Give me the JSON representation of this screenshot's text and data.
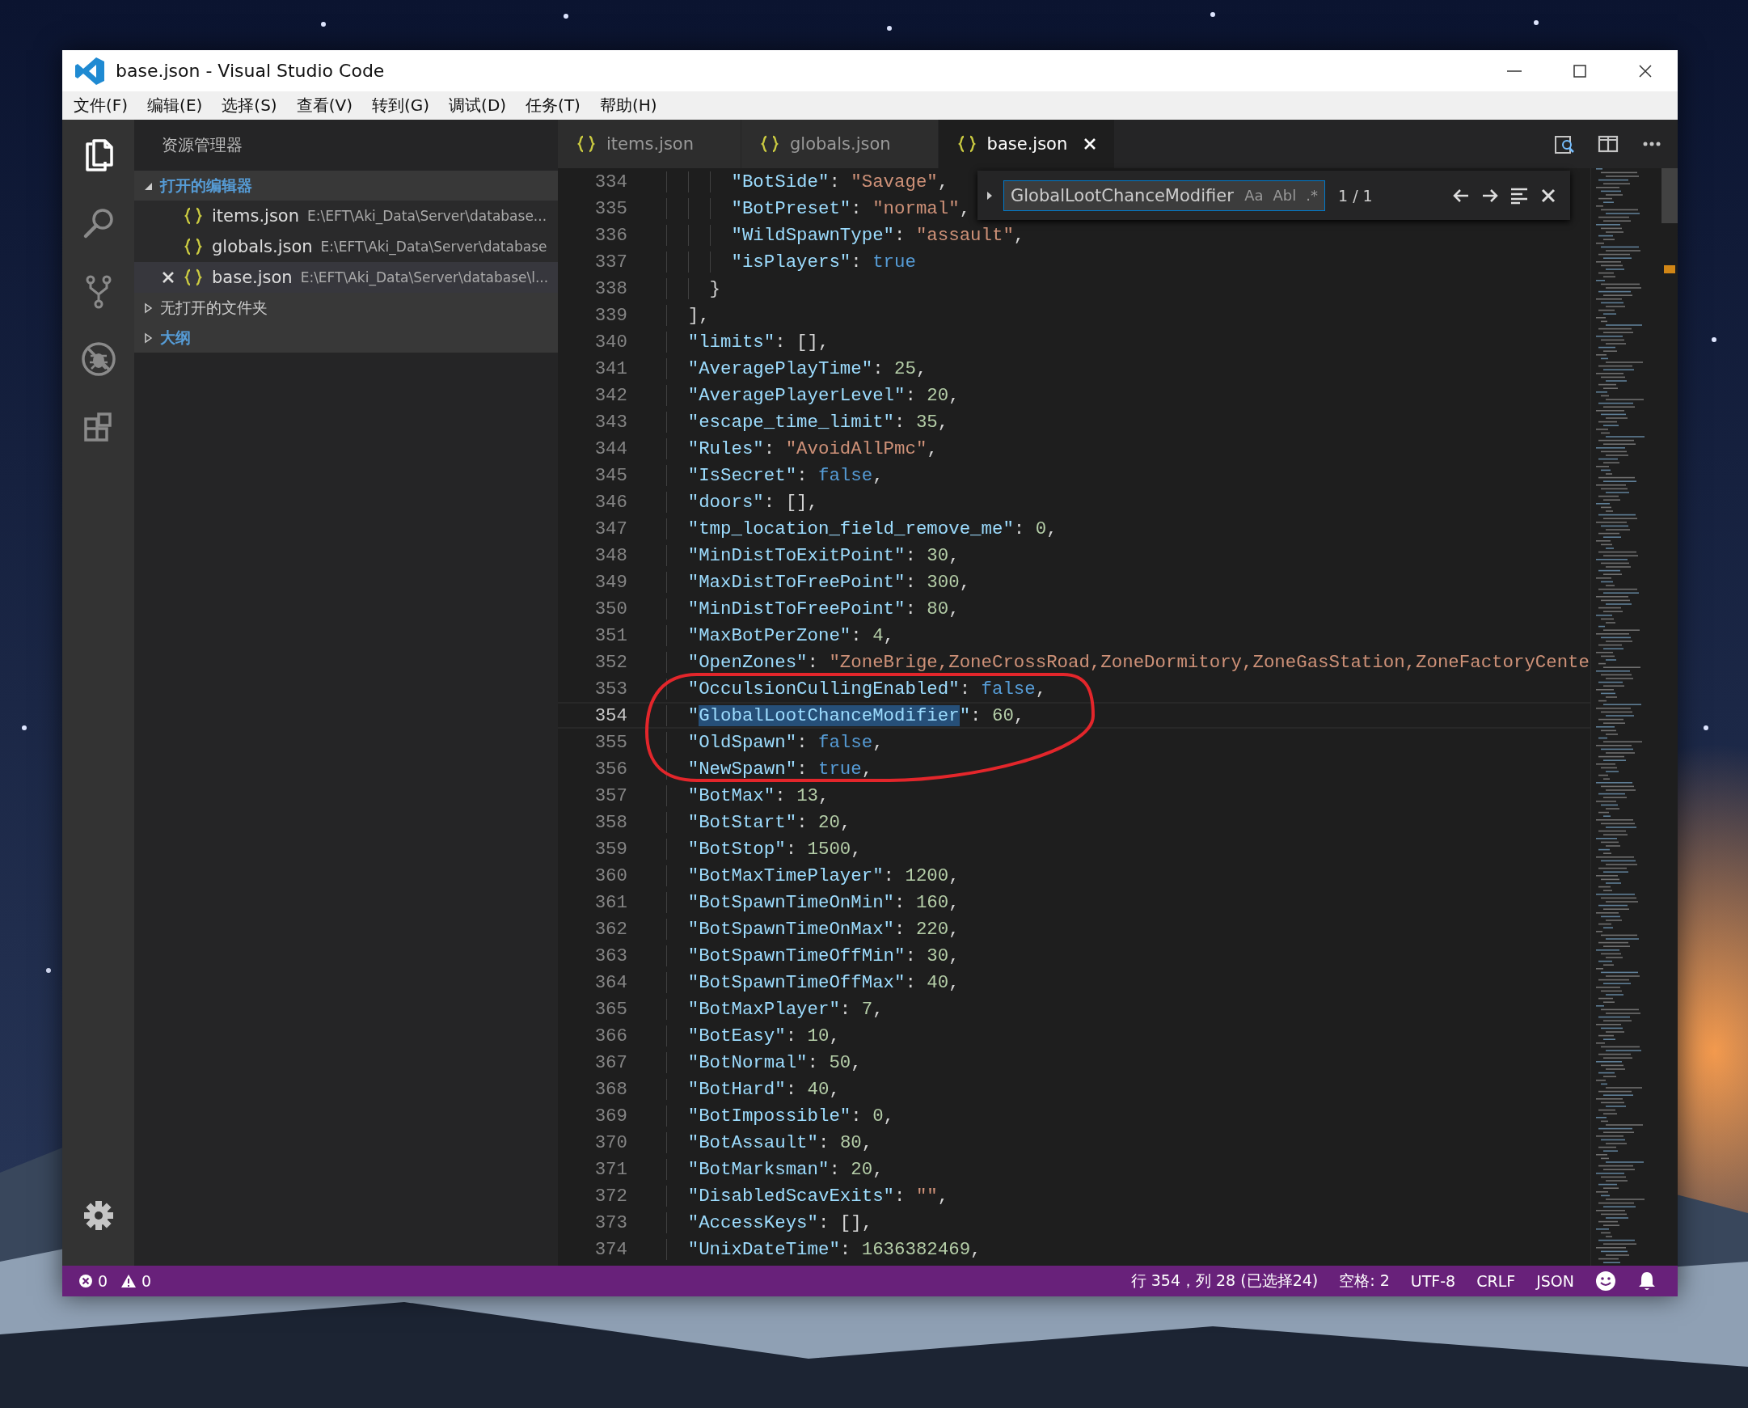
{
  "window": {
    "title": "base.json - Visual Studio Code"
  },
  "menu": [
    "文件(F)",
    "编辑(E)",
    "选择(S)",
    "查看(V)",
    "转到(G)",
    "调试(D)",
    "任务(T)",
    "帮助(H)"
  ],
  "activity_bar": [
    {
      "selected": true
    },
    {
      "selected": false
    },
    {
      "selected": false
    },
    {
      "selected": false
    },
    {
      "selected": false
    }
  ],
  "sidebar": {
    "title": "资源管理器",
    "sections": [
      {
        "title": "打开的编辑器",
        "expanded": true,
        "bold": true,
        "items": [
          {
            "name": "items.json",
            "path": "E:\\EFT\\Aki_Data\\Server\\database...",
            "selected": false
          },
          {
            "name": "globals.json",
            "path": "E:\\EFT\\Aki_Data\\Server\\database",
            "selected": false
          },
          {
            "name": "base.json",
            "path": "E:\\EFT\\Aki_Data\\Server\\database\\l...",
            "selected": true
          }
        ]
      },
      {
        "title": "无打开的文件夹",
        "expanded": false,
        "bold": false
      },
      {
        "title": "大纲",
        "expanded": false,
        "bold": true
      }
    ]
  },
  "tabs": [
    {
      "label": "items.json",
      "selected": false
    },
    {
      "label": "globals.json",
      "selected": false
    },
    {
      "label": "base.json",
      "selected": true
    }
  ],
  "find": {
    "value": "GlobalLootChanceModifier",
    "options": [
      "Aa",
      "Abl",
      ".*"
    ],
    "count": "1 / 1"
  },
  "editor": {
    "lines": [
      {
        "number": "334",
        "current": false,
        "tokens": [
          {
            "kind": "key",
            "text": "        \"BotSide\""
          },
          {
            "kind": "punct",
            "text": ": "
          },
          {
            "kind": "string",
            "text": "\"Savage\""
          },
          {
            "kind": "punct",
            "text": ","
          }
        ]
      },
      {
        "number": "335",
        "current": false,
        "tokens": [
          {
            "kind": "key",
            "text": "        \"BotPreset\""
          },
          {
            "kind": "punct",
            "text": ": "
          },
          {
            "kind": "string",
            "text": "\"normal\""
          },
          {
            "kind": "punct",
            "text": ","
          }
        ]
      },
      {
        "number": "336",
        "current": false,
        "tokens": [
          {
            "kind": "key",
            "text": "        \"WildSpawnType\""
          },
          {
            "kind": "punct",
            "text": ": "
          },
          {
            "kind": "string",
            "text": "\"assault\""
          },
          {
            "kind": "punct",
            "text": ","
          }
        ]
      },
      {
        "number": "337",
        "current": false,
        "tokens": [
          {
            "kind": "key",
            "text": "        \"isPlayers\""
          },
          {
            "kind": "punct",
            "text": ": "
          },
          {
            "kind": "boolean",
            "text": "true"
          }
        ]
      },
      {
        "number": "338",
        "current": false,
        "tokens": [
          {
            "kind": "punct",
            "text": "      }"
          }
        ]
      },
      {
        "number": "339",
        "current": false,
        "tokens": [
          {
            "kind": "punct",
            "text": "    ],"
          }
        ]
      },
      {
        "number": "340",
        "current": false,
        "tokens": [
          {
            "kind": "key",
            "text": "    \"limits\""
          },
          {
            "kind": "punct",
            "text": ": [],"
          }
        ]
      },
      {
        "number": "341",
        "current": false,
        "tokens": [
          {
            "kind": "key",
            "text": "    \"AveragePlayTime\""
          },
          {
            "kind": "punct",
            "text": ": "
          },
          {
            "kind": "number",
            "text": "25"
          },
          {
            "kind": "punct",
            "text": ","
          }
        ]
      },
      {
        "number": "342",
        "current": false,
        "tokens": [
          {
            "kind": "key",
            "text": "    \"AveragePlayerLevel\""
          },
          {
            "kind": "punct",
            "text": ": "
          },
          {
            "kind": "number",
            "text": "20"
          },
          {
            "kind": "punct",
            "text": ","
          }
        ]
      },
      {
        "number": "343",
        "current": false,
        "tokens": [
          {
            "kind": "key",
            "text": "    \"escape_time_limit\""
          },
          {
            "kind": "punct",
            "text": ": "
          },
          {
            "kind": "number",
            "text": "35"
          },
          {
            "kind": "punct",
            "text": ","
          }
        ]
      },
      {
        "number": "344",
        "current": false,
        "tokens": [
          {
            "kind": "key",
            "text": "    \"Rules\""
          },
          {
            "kind": "punct",
            "text": ": "
          },
          {
            "kind": "string",
            "text": "\"AvoidAllPmc\""
          },
          {
            "kind": "punct",
            "text": ","
          }
        ]
      },
      {
        "number": "345",
        "current": false,
        "tokens": [
          {
            "kind": "key",
            "text": "    \"IsSecret\""
          },
          {
            "kind": "punct",
            "text": ": "
          },
          {
            "kind": "boolean",
            "text": "false"
          },
          {
            "kind": "punct",
            "text": ","
          }
        ]
      },
      {
        "number": "346",
        "current": false,
        "tokens": [
          {
            "kind": "key",
            "text": "    \"doors\""
          },
          {
            "kind": "punct",
            "text": ": [],"
          }
        ]
      },
      {
        "number": "347",
        "current": false,
        "tokens": [
          {
            "kind": "key",
            "text": "    \"tmp_location_field_remove_me\""
          },
          {
            "kind": "punct",
            "text": ": "
          },
          {
            "kind": "number",
            "text": "0"
          },
          {
            "kind": "punct",
            "text": ","
          }
        ]
      },
      {
        "number": "348",
        "current": false,
        "tokens": [
          {
            "kind": "key",
            "text": "    \"MinDistToExitPoint\""
          },
          {
            "kind": "punct",
            "text": ": "
          },
          {
            "kind": "number",
            "text": "30"
          },
          {
            "kind": "punct",
            "text": ","
          }
        ]
      },
      {
        "number": "349",
        "current": false,
        "tokens": [
          {
            "kind": "key",
            "text": "    \"MaxDistToFreePoint\""
          },
          {
            "kind": "punct",
            "text": ": "
          },
          {
            "kind": "number",
            "text": "300"
          },
          {
            "kind": "punct",
            "text": ","
          }
        ]
      },
      {
        "number": "350",
        "current": false,
        "tokens": [
          {
            "kind": "key",
            "text": "    \"MinDistToFreePoint\""
          },
          {
            "kind": "punct",
            "text": ": "
          },
          {
            "kind": "number",
            "text": "80"
          },
          {
            "kind": "punct",
            "text": ","
          }
        ]
      },
      {
        "number": "351",
        "current": false,
        "tokens": [
          {
            "kind": "key",
            "text": "    \"MaxBotPerZone\""
          },
          {
            "kind": "punct",
            "text": ": "
          },
          {
            "kind": "number",
            "text": "4"
          },
          {
            "kind": "punct",
            "text": ","
          }
        ]
      },
      {
        "number": "352",
        "current": false,
        "tokens": [
          {
            "kind": "key",
            "text": "    \"OpenZones\""
          },
          {
            "kind": "punct",
            "text": ": "
          },
          {
            "kind": "string",
            "text": "\"ZoneBrige,ZoneCrossRoad,ZoneDormitory,ZoneGasStation,ZoneFactoryCente"
          }
        ]
      },
      {
        "number": "353",
        "current": false,
        "tokens": [
          {
            "kind": "key",
            "text": "    \"OcculsionCullingEnabled\""
          },
          {
            "kind": "punct",
            "text": ": "
          },
          {
            "kind": "boolean",
            "text": "false"
          },
          {
            "kind": "punct",
            "text": ","
          }
        ]
      },
      {
        "number": "354",
        "current": true,
        "tokens": [
          {
            "kind": "key",
            "text": "    \""
          },
          {
            "kind": "selection",
            "text": "GlobalLootChanceModifier"
          },
          {
            "kind": "key",
            "text": "\""
          },
          {
            "kind": "punct",
            "text": ": "
          },
          {
            "kind": "number",
            "text": "60"
          },
          {
            "kind": "punct",
            "text": ","
          }
        ]
      },
      {
        "number": "355",
        "current": false,
        "tokens": [
          {
            "kind": "key",
            "text": "    \"OldSpawn\""
          },
          {
            "kind": "punct",
            "text": ": "
          },
          {
            "kind": "boolean",
            "text": "false"
          },
          {
            "kind": "punct",
            "text": ","
          }
        ]
      },
      {
        "number": "356",
        "current": false,
        "tokens": [
          {
            "kind": "key",
            "text": "    \"NewSpawn\""
          },
          {
            "kind": "punct",
            "text": ": "
          },
          {
            "kind": "boolean",
            "text": "true"
          },
          {
            "kind": "punct",
            "text": ","
          }
        ]
      },
      {
        "number": "357",
        "current": false,
        "tokens": [
          {
            "kind": "key",
            "text": "    \"BotMax\""
          },
          {
            "kind": "punct",
            "text": ": "
          },
          {
            "kind": "number",
            "text": "13"
          },
          {
            "kind": "punct",
            "text": ","
          }
        ]
      },
      {
        "number": "358",
        "current": false,
        "tokens": [
          {
            "kind": "key",
            "text": "    \"BotStart\""
          },
          {
            "kind": "punct",
            "text": ": "
          },
          {
            "kind": "number",
            "text": "20"
          },
          {
            "kind": "punct",
            "text": ","
          }
        ]
      },
      {
        "number": "359",
        "current": false,
        "tokens": [
          {
            "kind": "key",
            "text": "    \"BotStop\""
          },
          {
            "kind": "punct",
            "text": ": "
          },
          {
            "kind": "number",
            "text": "1500"
          },
          {
            "kind": "punct",
            "text": ","
          }
        ]
      },
      {
        "number": "360",
        "current": false,
        "tokens": [
          {
            "kind": "key",
            "text": "    \"BotMaxTimePlayer\""
          },
          {
            "kind": "punct",
            "text": ": "
          },
          {
            "kind": "number",
            "text": "1200"
          },
          {
            "kind": "punct",
            "text": ","
          }
        ]
      },
      {
        "number": "361",
        "current": false,
        "tokens": [
          {
            "kind": "key",
            "text": "    \"BotSpawnTimeOnMin\""
          },
          {
            "kind": "punct",
            "text": ": "
          },
          {
            "kind": "number",
            "text": "160"
          },
          {
            "kind": "punct",
            "text": ","
          }
        ]
      },
      {
        "number": "362",
        "current": false,
        "tokens": [
          {
            "kind": "key",
            "text": "    \"BotSpawnTimeOnMax\""
          },
          {
            "kind": "punct",
            "text": ": "
          },
          {
            "kind": "number",
            "text": "220"
          },
          {
            "kind": "punct",
            "text": ","
          }
        ]
      },
      {
        "number": "363",
        "current": false,
        "tokens": [
          {
            "kind": "key",
            "text": "    \"BotSpawnTimeOffMin\""
          },
          {
            "kind": "punct",
            "text": ": "
          },
          {
            "kind": "number",
            "text": "30"
          },
          {
            "kind": "punct",
            "text": ","
          }
        ]
      },
      {
        "number": "364",
        "current": false,
        "tokens": [
          {
            "kind": "key",
            "text": "    \"BotSpawnTimeOffMax\""
          },
          {
            "kind": "punct",
            "text": ": "
          },
          {
            "kind": "number",
            "text": "40"
          },
          {
            "kind": "punct",
            "text": ","
          }
        ]
      },
      {
        "number": "365",
        "current": false,
        "tokens": [
          {
            "kind": "key",
            "text": "    \"BotMaxPlayer\""
          },
          {
            "kind": "punct",
            "text": ": "
          },
          {
            "kind": "number",
            "text": "7"
          },
          {
            "kind": "punct",
            "text": ","
          }
        ]
      },
      {
        "number": "366",
        "current": false,
        "tokens": [
          {
            "kind": "key",
            "text": "    \"BotEasy\""
          },
          {
            "kind": "punct",
            "text": ": "
          },
          {
            "kind": "number",
            "text": "10"
          },
          {
            "kind": "punct",
            "text": ","
          }
        ]
      },
      {
        "number": "367",
        "current": false,
        "tokens": [
          {
            "kind": "key",
            "text": "    \"BotNormal\""
          },
          {
            "kind": "punct",
            "text": ": "
          },
          {
            "kind": "number",
            "text": "50"
          },
          {
            "kind": "punct",
            "text": ","
          }
        ]
      },
      {
        "number": "368",
        "current": false,
        "tokens": [
          {
            "kind": "key",
            "text": "    \"BotHard\""
          },
          {
            "kind": "punct",
            "text": ": "
          },
          {
            "kind": "number",
            "text": "40"
          },
          {
            "kind": "punct",
            "text": ","
          }
        ]
      },
      {
        "number": "369",
        "current": false,
        "tokens": [
          {
            "kind": "key",
            "text": "    \"BotImpossible\""
          },
          {
            "kind": "punct",
            "text": ": "
          },
          {
            "kind": "number",
            "text": "0"
          },
          {
            "kind": "punct",
            "text": ","
          }
        ]
      },
      {
        "number": "370",
        "current": false,
        "tokens": [
          {
            "kind": "key",
            "text": "    \"BotAssault\""
          },
          {
            "kind": "punct",
            "text": ": "
          },
          {
            "kind": "number",
            "text": "80"
          },
          {
            "kind": "punct",
            "text": ","
          }
        ]
      },
      {
        "number": "371",
        "current": false,
        "tokens": [
          {
            "kind": "key",
            "text": "    \"BotMarksman\""
          },
          {
            "kind": "punct",
            "text": ": "
          },
          {
            "kind": "number",
            "text": "20"
          },
          {
            "kind": "punct",
            "text": ","
          }
        ]
      },
      {
        "number": "372",
        "current": false,
        "tokens": [
          {
            "kind": "key",
            "text": "    \"DisabledScavExits\""
          },
          {
            "kind": "punct",
            "text": ": "
          },
          {
            "kind": "string",
            "text": "\"\""
          },
          {
            "kind": "punct",
            "text": ","
          }
        ]
      },
      {
        "number": "373",
        "current": false,
        "tokens": [
          {
            "kind": "key",
            "text": "    \"AccessKeys\""
          },
          {
            "kind": "punct",
            "text": ": [],"
          }
        ]
      },
      {
        "number": "374",
        "current": false,
        "tokens": [
          {
            "kind": "key",
            "text": "    \"UnixDateTime\""
          },
          {
            "kind": "punct",
            "text": ": "
          },
          {
            "kind": "number",
            "text": "1636382469"
          },
          {
            "kind": "punct",
            "text": ","
          }
        ]
      }
    ]
  },
  "status_bar": {
    "errors": "0",
    "warnings": "0",
    "items": [
      "行 354，列 28 (已选择24)",
      "空格: 2",
      "UTF-8",
      "CRLF",
      "JSON"
    ]
  }
}
